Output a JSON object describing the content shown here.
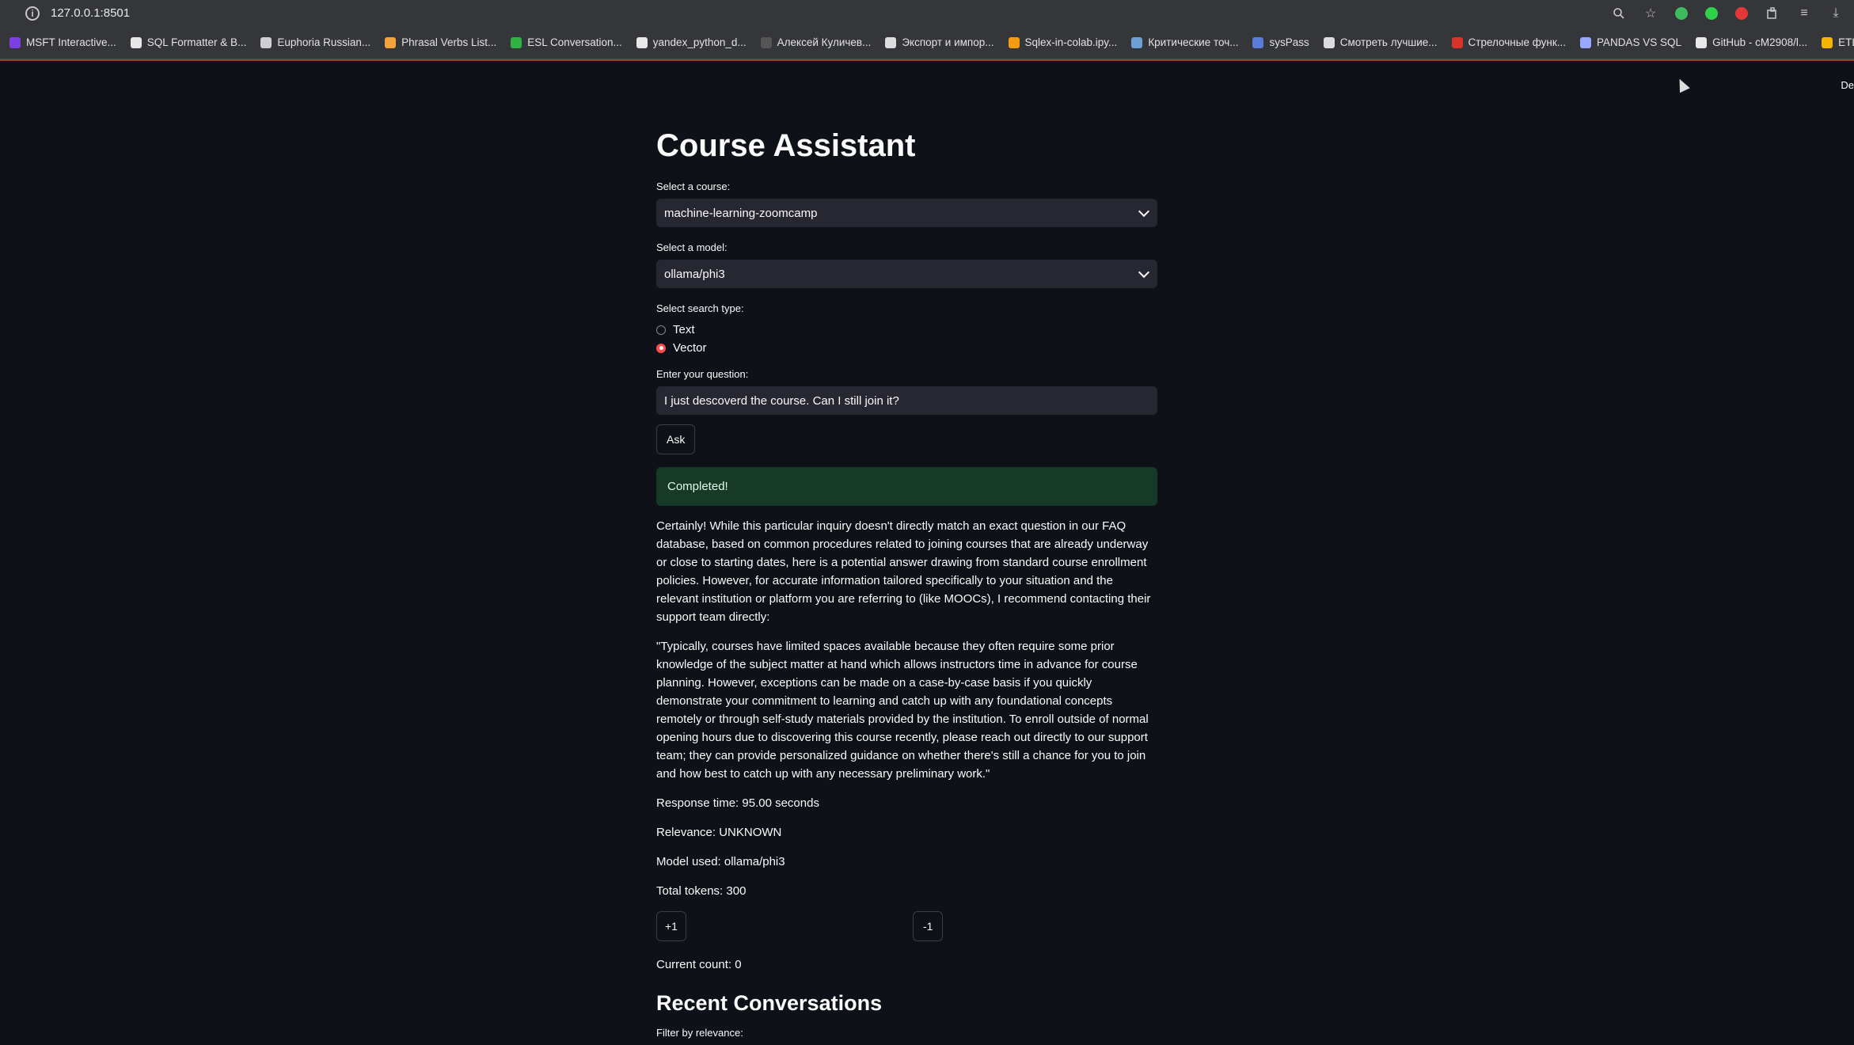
{
  "browser": {
    "url": "127.0.0.1:8501",
    "bookmarks": [
      {
        "label": "MSFT Interactive...",
        "color": "#7b3fe4"
      },
      {
        "label": "SQL Formatter & B...",
        "color": "#e6e6e6"
      },
      {
        "label": "Euphoria Russian...",
        "color": "#cfcfcf"
      },
      {
        "label": "Phrasal Verbs List...",
        "color": "#f2a33a"
      },
      {
        "label": "ESL Conversation...",
        "color": "#2fb344"
      },
      {
        "label": "yandex_python_d...",
        "color": "#e8e8e8"
      },
      {
        "label": "Алексей Куличев...",
        "color": "#555555"
      },
      {
        "label": "Экспорт и импор...",
        "color": "#dddddd"
      },
      {
        "label": "Sqlex-in-colab.ipy...",
        "color": "#f39c12"
      },
      {
        "label": "Критические точ...",
        "color": "#6ea0d8"
      },
      {
        "label": "sysPass",
        "color": "#5a7bd6"
      },
      {
        "label": "Смотреть лучшие...",
        "color": "#dddddd"
      },
      {
        "label": "Стрелочные функ...",
        "color": "#d9342b"
      },
      {
        "label": "PANDAS VS SQL",
        "color": "#9aa7ff"
      },
      {
        "label": "GitHub - cM2908/l...",
        "color": "#e8e8e8"
      },
      {
        "label": "ETL/ELT инструме...",
        "color": "#f4b400"
      }
    ]
  },
  "app": {
    "title": "Course Assistant",
    "course_label": "Select a course:",
    "course_value": "machine-learning-zoomcamp",
    "model_label": "Select a model:",
    "model_value": "ollama/phi3",
    "search_label": "Select search type:",
    "search_options": [
      "Text",
      "Vector"
    ],
    "search_selected": "Vector",
    "question_label": "Enter your question:",
    "question_value": "I just descoverd the course. Can I still join it?",
    "ask_label": "Ask",
    "status": "Completed!",
    "answer_p1": "Certainly! While this particular inquiry doesn't directly match an exact question in our FAQ database, based on common procedures related to joining courses that are already underway or close to starting dates, here is a potential answer drawing from standard course enrollment policies. However, for accurate information tailored specifically to your situation and the relevant institution or platform you are referring to (like MOOCs), I recommend contacting their support team directly:",
    "answer_p2": "\"Typically, courses have limited spaces available because they often require some prior knowledge of the subject matter at hand which allows instructors time in advance for course planning. However, exceptions can be made on a case-by-case basis if you quickly demonstrate your commitment to learning and catch up with any foundational concepts remotely or through self-study materials provided by the institution. To enroll outside of normal opening hours due to discovering this course recently, please reach out directly to our support team; they can provide personalized guidance on whether there's still a chance for you to join and how best to catch up with any necessary preliminary work.\"",
    "response_time": "Response time: 95.00 seconds",
    "relevance": "Relevance: UNKNOWN",
    "model_used": "Model used: ollama/phi3",
    "total_tokens": "Total tokens: 300",
    "plus_label": "+1",
    "minus_label": "-1",
    "current_count": "Current count: 0",
    "recent_title": "Recent Conversations",
    "filter_label": "Filter by relevance:",
    "deploy_label": "De"
  }
}
